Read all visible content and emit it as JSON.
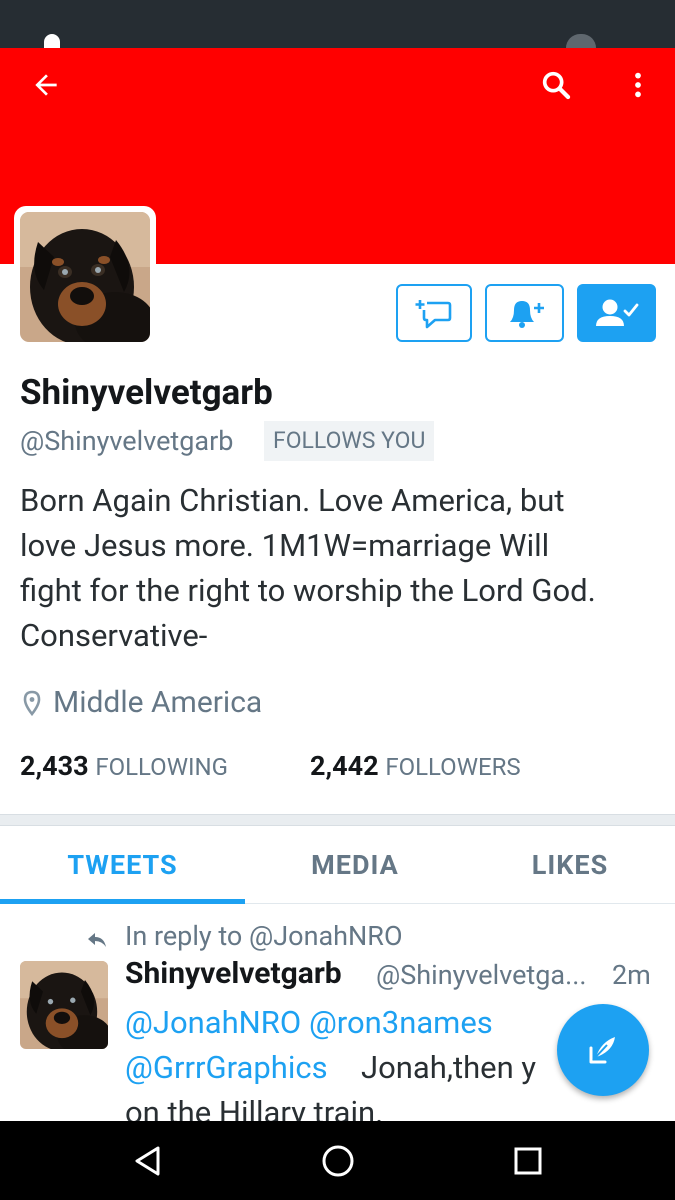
{
  "colors": {
    "header_bg": "#ff0000",
    "accent": "#1da1f2",
    "status_bar": "#262d33",
    "nav_bar": "#000000"
  },
  "header": {
    "back_icon": "arrow-left-icon",
    "search_icon": "search-icon",
    "overflow_icon": "more-vert-icon"
  },
  "actions": {
    "message_icon": "message-plus-icon",
    "notify_icon": "bell-plus-icon",
    "following_icon": "person-check-icon"
  },
  "profile": {
    "display_name": "Shinyvelvetgarb",
    "handle": "@Shinyvelvetgarb",
    "follows_you": "FOLLOWS YOU",
    "bio_lines": [
      "Born Again Christian. Love America, but",
      "love Jesus more. 1M1W=marriage Will",
      "fight for the right to worship the Lord God.",
      "Conservative-"
    ],
    "location": "Middle America",
    "following_count": "2,433",
    "following_label": "FOLLOWING",
    "followers_count": "2,442",
    "followers_label": "FOLLOWERS"
  },
  "tabs": [
    {
      "label": "TWEETS",
      "active": true
    },
    {
      "label": "MEDIA",
      "active": false
    },
    {
      "label": "LIKES",
      "active": false
    }
  ],
  "tweet": {
    "reply_context": "In reply to @JonahNRO",
    "name": "Shinyvelvetgarb",
    "handle": "@Shinyvelvetga...",
    "time": "2m",
    "mention_1": "@JonahNRO",
    "mention_2": "@ron3names",
    "mention_3": "@GrrrGraphics",
    "text_1": "Jonah,then y",
    "text_2": "on the Hillary train."
  },
  "fab": {
    "icon": "compose-tweet-icon"
  },
  "nav": {
    "back_icon": "nav-back-icon",
    "home_icon": "nav-home-icon",
    "recents_icon": "nav-recents-icon"
  }
}
